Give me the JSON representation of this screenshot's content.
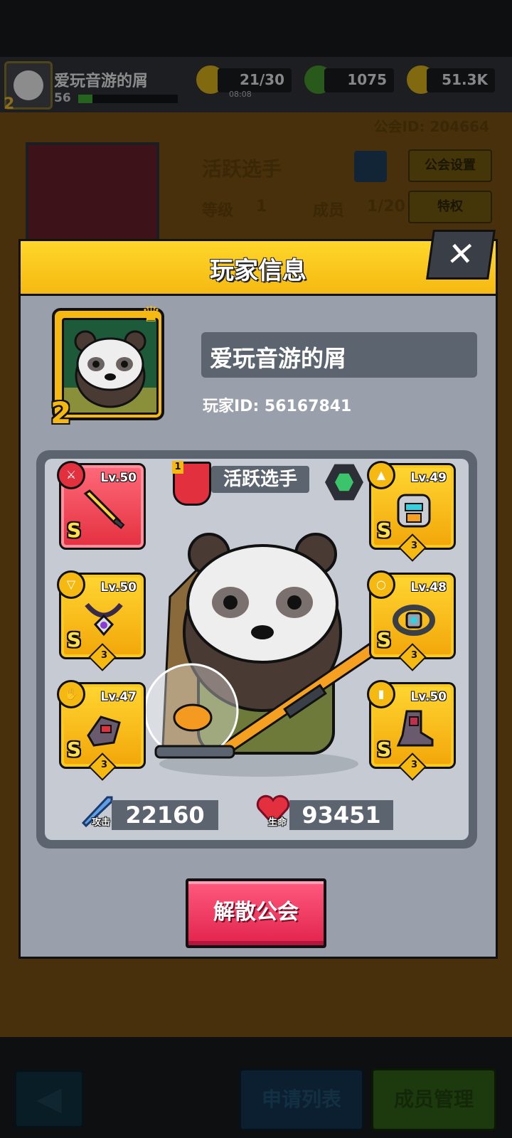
{
  "topbar": {
    "player_name": "爱玩音游的屑",
    "player_level": "56",
    "xp_progress": 0.14,
    "energy": "21/30",
    "energy_timer": "08:08",
    "gems": "1075",
    "gold": "51.3K"
  },
  "guild": {
    "guild_id_text": "公会ID: 204664",
    "name": "活跃选手",
    "settings_button": "公会设置",
    "level_label": "等级",
    "level_value": "1",
    "members_label": "成员",
    "members_value": "1/20",
    "privilege_button": "特权"
  },
  "bottom_nav": {
    "back_icon": "arrow-left-icon",
    "apply_list": "申请列表",
    "member_manage": "成员管理"
  },
  "modal": {
    "title": "玩家信息",
    "close_label": "✕",
    "avatar_level": "2",
    "player_name": "爱玩音游的屑",
    "player_id": "玩家ID: 56167841",
    "guild_rank": "1",
    "guild_name": "活跃选手",
    "equipment": [
      {
        "slot": "weapon",
        "icon": "sword-icon",
        "level": "Lv.50",
        "rank": "S",
        "stars": ""
      },
      {
        "slot": "armor",
        "icon": "shirt-icon",
        "level": "Lv.49",
        "rank": "S",
        "stars": "3"
      },
      {
        "slot": "necklace",
        "icon": "necklace-icon",
        "level": "Lv.50",
        "rank": "S",
        "stars": "3"
      },
      {
        "slot": "belt",
        "icon": "ring-icon",
        "level": "Lv.48",
        "rank": "S",
        "stars": "3"
      },
      {
        "slot": "gloves",
        "icon": "glove-icon",
        "level": "Lv.47",
        "rank": "S",
        "stars": "3"
      },
      {
        "slot": "boots",
        "icon": "boot-icon",
        "level": "Lv.50",
        "rank": "S",
        "stars": "3"
      }
    ],
    "attack_label": "攻击",
    "attack_value": "22160",
    "hp_label": "生命",
    "hp_value": "93451",
    "disband_button": "解散公会"
  },
  "colors": {
    "header_yellow": "#f5b912",
    "disband_red": "#e2234c",
    "legendary_gold": "#ffd632",
    "weapon_red": "#e3303f"
  }
}
